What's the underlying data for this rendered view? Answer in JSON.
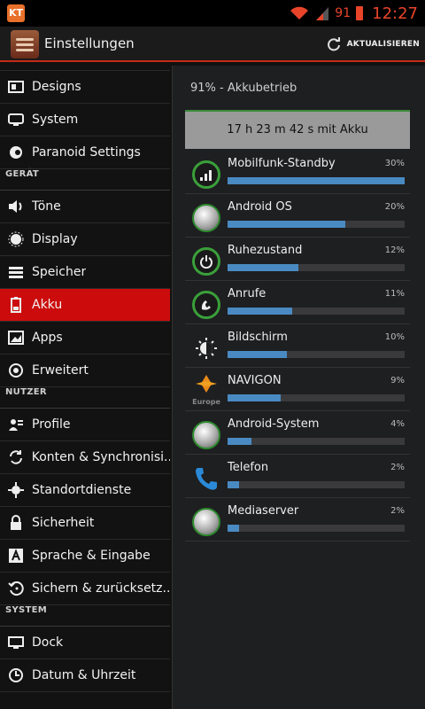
{
  "status_bar": {
    "app_badge": "KT",
    "battery_level": "91",
    "time": "12:27",
    "accent_color": "#e8442a",
    "icons": [
      "kt-app-icon",
      "wifi-icon",
      "signal-icon",
      "battery-icon"
    ]
  },
  "action_bar": {
    "title": "Einstellungen",
    "refresh_label": "AKTUALISIEREN",
    "accent_color": "#c52a17"
  },
  "sidebar": {
    "items_top": [
      {
        "label": "Designs",
        "icon": "designs-icon"
      },
      {
        "label": "System",
        "icon": "system-icon"
      },
      {
        "label": "Paranoid Settings",
        "icon": "paranoid-icon"
      }
    ],
    "section_device": "GERÄT",
    "items_device": [
      {
        "label": "Töne",
        "icon": "sound-icon"
      },
      {
        "label": "Display",
        "icon": "display-icon"
      },
      {
        "label": "Speicher",
        "icon": "storage-icon"
      },
      {
        "label": "Akku",
        "icon": "battery-icon",
        "active": true
      },
      {
        "label": "Apps",
        "icon": "apps-icon"
      },
      {
        "label": "Erweitert",
        "icon": "advanced-icon"
      }
    ],
    "section_user": "NUTZER",
    "items_user": [
      {
        "label": "Profile",
        "icon": "profile-icon"
      },
      {
        "label": "Konten & Synchronisi..",
        "icon": "sync-icon"
      },
      {
        "label": "Standortdienste",
        "icon": "location-icon"
      },
      {
        "label": "Sicherheit",
        "icon": "lock-icon"
      },
      {
        "label": "Sprache & Eingabe",
        "icon": "language-icon"
      },
      {
        "label": "Sichern & zurücksetz..",
        "icon": "backup-icon"
      }
    ],
    "section_system": "SYSTEM",
    "items_system": [
      {
        "label": "Dock",
        "icon": "dock-icon"
      },
      {
        "label": "Datum & Uhrzeit",
        "icon": "clock-icon"
      }
    ],
    "active_color": "#cc0c0c"
  },
  "battery_panel": {
    "header": "91% - Akkubetrieb",
    "summary": "17 h 23 m 42 s mit Akku",
    "bar_color": "#4a8ac2",
    "usage": [
      {
        "name": "Mobilfunk-Standby",
        "percent_label": "30%",
        "value": 30,
        "icon": "cell-standby-icon"
      },
      {
        "name": "Android OS",
        "percent_label": "20%",
        "value": 20,
        "icon": "android-os-icon"
      },
      {
        "name": "Ruhezustand",
        "percent_label": "12%",
        "value": 12,
        "icon": "power-icon"
      },
      {
        "name": "Anrufe",
        "percent_label": "11%",
        "value": 11,
        "icon": "phone-call-icon"
      },
      {
        "name": "Bildschirm",
        "percent_label": "10%",
        "value": 10,
        "icon": "brightness-icon"
      },
      {
        "name": "NAVIGON",
        "percent_label": "9%",
        "value": 9,
        "icon": "navigon-icon"
      },
      {
        "name": "Android-System",
        "percent_label": "4%",
        "value": 4,
        "icon": "android-system-icon"
      },
      {
        "name": "Telefon",
        "percent_label": "2%",
        "value": 2,
        "icon": "telephone-icon"
      },
      {
        "name": "Mediaserver",
        "percent_label": "2%",
        "value": 2,
        "icon": "mediaserver-icon"
      }
    ],
    "navigon_sub": "Europe"
  }
}
